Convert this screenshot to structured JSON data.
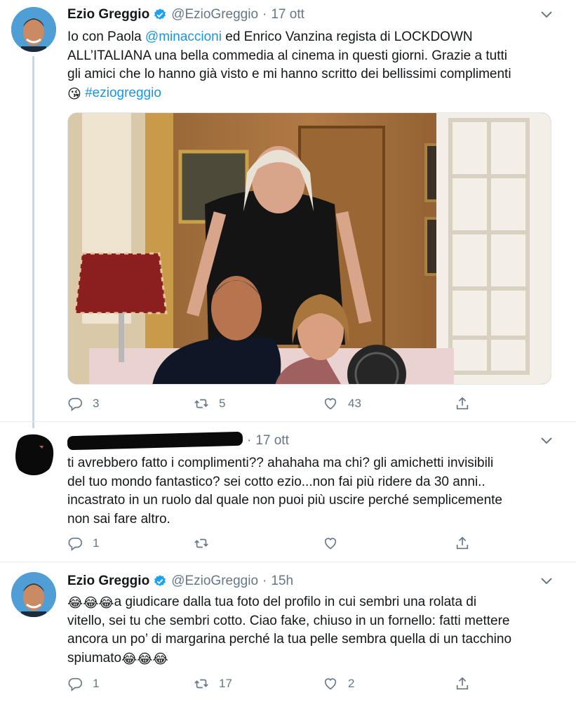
{
  "tweets": [
    {
      "author": "Ezio Greggio",
      "handle": "@EzioGreggio",
      "separator": "·",
      "time": "17 ott",
      "lines": [
        {
          "pre": "Io con Paola ",
          "link": "@minaccioni",
          "post": " ed Enrico Vanzina regista di LOCKDOWN"
        },
        {
          "pre": "ALL’ITALIANA una bella commedia al cinema in questi giorni. Grazie a tutti"
        },
        {
          "pre": "gli amici che lo hanno già visto e mi hanno scritto dei bellissimi complimenti"
        },
        {
          "emoji": "😘",
          "link": "#eziogreggio"
        }
      ],
      "replies": "3",
      "retweets": "5",
      "likes": "43"
    },
    {
      "author_redacted": true,
      "time": "17 ott",
      "lines": [
        "ti avrebbero fatto i complimenti?? ahahaha ma chi? gli amichetti invisibili",
        "del tuo mondo fantastico? sei cotto ezio...non fai più ridere da 30 anni..",
        "incastrato in un ruolo dal quale non puoi più uscire perché semplicemente",
        "non sai fare altro."
      ],
      "replies": "1",
      "retweets": "",
      "likes": ""
    },
    {
      "author": "Ezio Greggio",
      "handle": "@EzioGreggio",
      "separator": "·",
      "time": "15h",
      "lines": [
        {
          "emoji": "😂😂😂",
          "pre": "a giudicare dalla tua foto del profilo in cui sembri una rolata di"
        },
        {
          "pre": "vitello, sei tu che sembri cotto. Ciao fake, chiuso in un fornello: fatti mettere"
        },
        {
          "pre": "ancora un po’ di margarina perché la tua pelle sembra quella di un tacchino"
        },
        {
          "pre": "spiumato",
          "emoji": "😂😂😂"
        }
      ],
      "replies": "1",
      "retweets": "17",
      "likes": "2"
    }
  ],
  "icons": {
    "verified": "verified-badge-icon",
    "more": "chevron-down-icon",
    "reply": "reply-icon",
    "retweet": "retweet-icon",
    "like": "heart-icon",
    "share": "share-icon"
  },
  "colors": {
    "link": "#1b95e0",
    "secondary": "#657786",
    "verified": "#1da1f2"
  }
}
